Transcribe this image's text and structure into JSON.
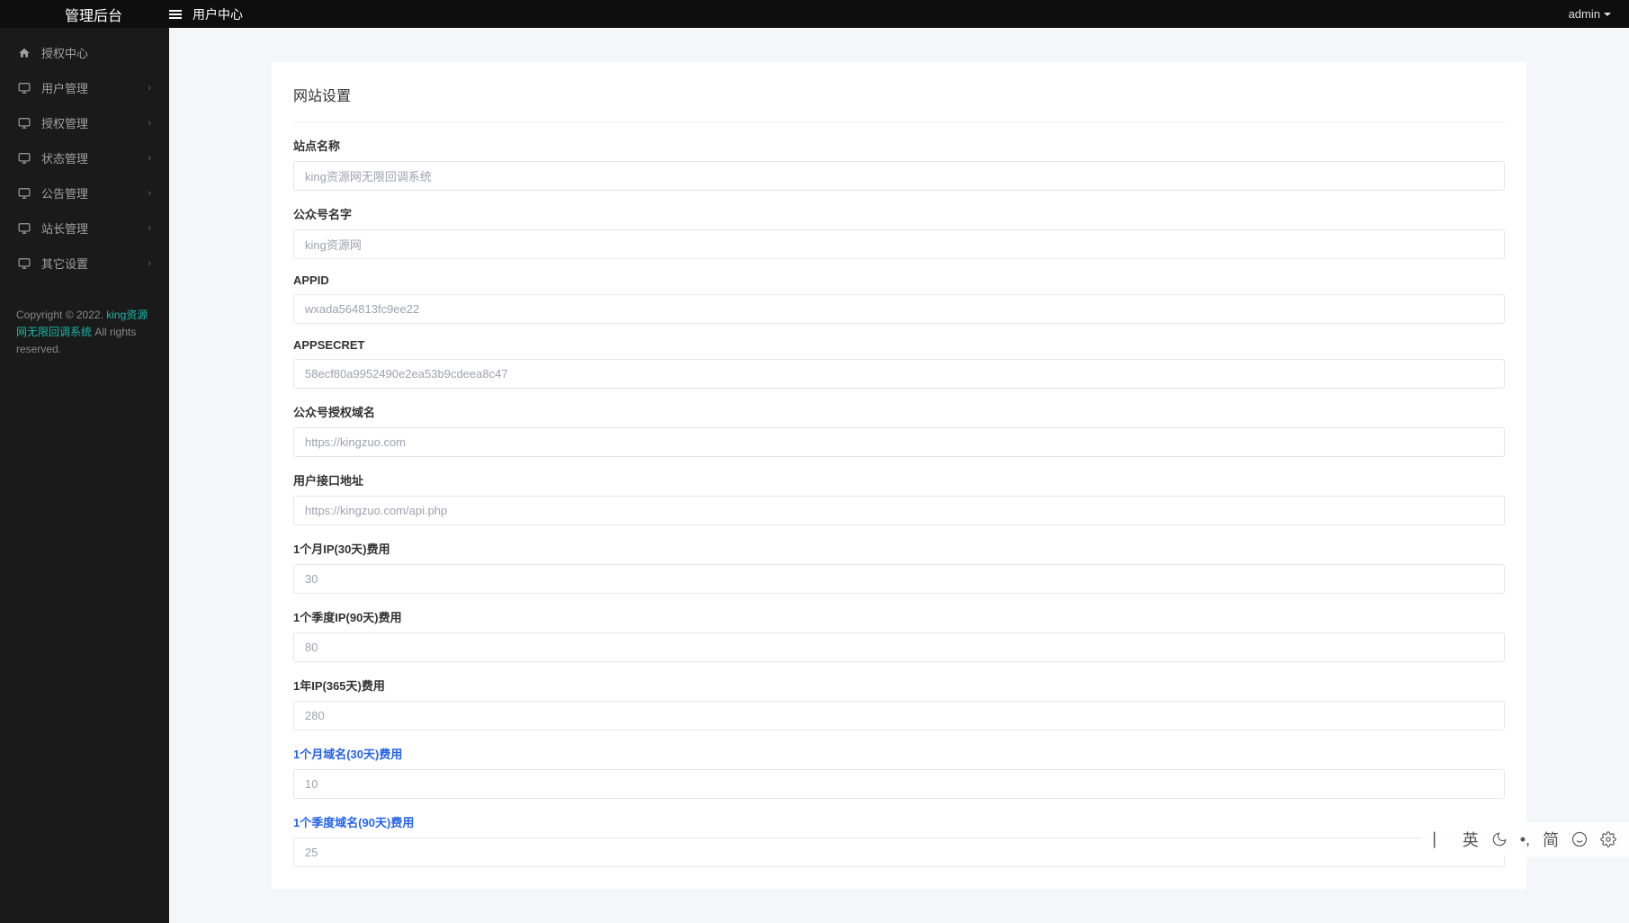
{
  "topbar": {
    "logo": "管理后台",
    "breadcrumb": "用户中心",
    "user": "admin"
  },
  "sidebar": {
    "items": [
      {
        "label": "授权中心",
        "icon": "home",
        "expandable": false
      },
      {
        "label": "用户管理",
        "icon": "monitor",
        "expandable": true
      },
      {
        "label": "授权管理",
        "icon": "monitor",
        "expandable": true
      },
      {
        "label": "状态管理",
        "icon": "monitor",
        "expandable": true
      },
      {
        "label": "公告管理",
        "icon": "monitor",
        "expandable": true
      },
      {
        "label": "站长管理",
        "icon": "monitor",
        "expandable": true
      },
      {
        "label": "其它设置",
        "icon": "monitor",
        "expandable": true
      }
    ],
    "footer": {
      "copyright_prefix": "Copyright © 2022. ",
      "brand": "king资源网无限回调系统",
      "rights": " All rights reserved."
    }
  },
  "page": {
    "title": "网站设置",
    "fields": [
      {
        "label": "站点名称",
        "value": "king资源网无限回调系统",
        "blue": false
      },
      {
        "label": "公众号名字",
        "value": "king资源网",
        "blue": false
      },
      {
        "label": "APPID",
        "value": "wxada564813fc9ee22",
        "blue": false
      },
      {
        "label": "APPSECRET",
        "value": "58ecf80a9952490e2ea53b9cdeea8c47",
        "blue": false
      },
      {
        "label": "公众号授权域名",
        "value": "https://kingzuo.com",
        "blue": false
      },
      {
        "label": "用户接口地址",
        "value": "https://kingzuo.com/api.php",
        "blue": false
      },
      {
        "label": "1个月IP(30天)费用",
        "value": "30",
        "blue": false
      },
      {
        "label": "1个季度IP(90天)费用",
        "value": "80",
        "blue": false
      },
      {
        "label": "1年IP(365天)费用",
        "value": "280",
        "blue": false
      },
      {
        "label": "1个月域名(30天)费用",
        "value": "10",
        "blue": true
      },
      {
        "label": "1个季度域名(90天)费用",
        "value": "25",
        "blue": true
      }
    ]
  },
  "ime": {
    "items": [
      "⟊",
      "英",
      "☽",
      "•,",
      "简",
      "☺",
      "⚙"
    ]
  }
}
